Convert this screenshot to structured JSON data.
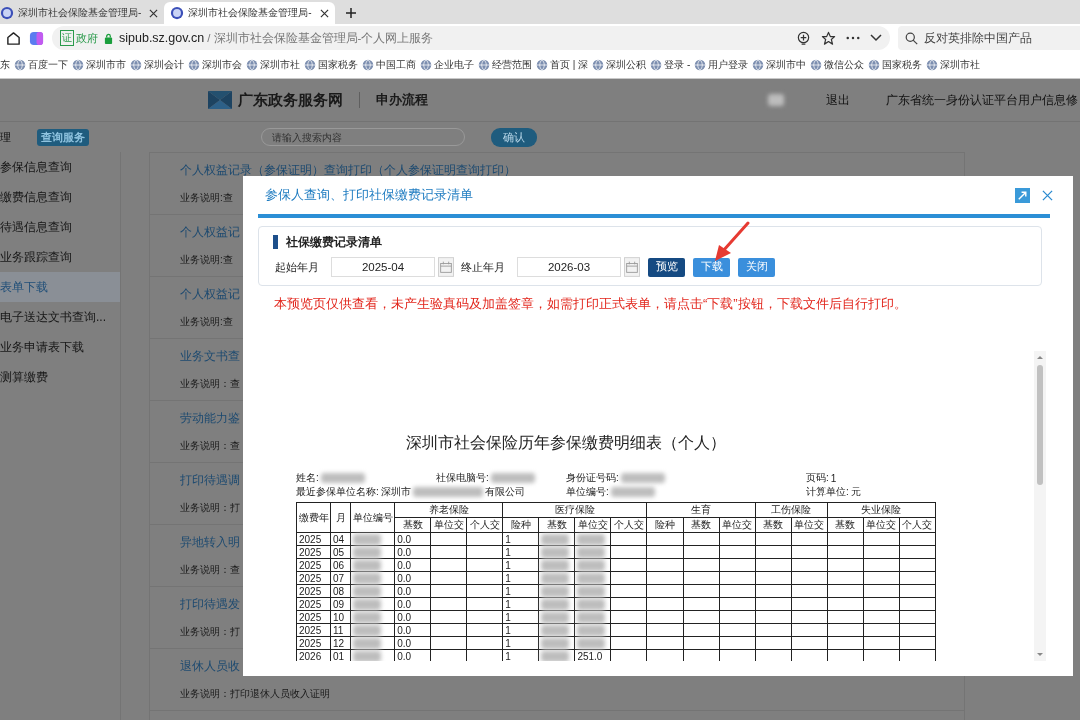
{
  "browser": {
    "tabs": [
      {
        "title": "深圳市社会保险基金管理局-",
        "selected": false
      },
      {
        "title": "深圳市社会保险基金管理局-",
        "selected": true
      }
    ],
    "address": {
      "badge_mark": "证",
      "badge": "政府",
      "domain": "sipub.sz.gov.cn",
      "path": "/ 深圳市社会保险基金管理局-个人网上服务"
    },
    "search": {
      "placeholder": "反对英排除中国产品"
    },
    "bookmarks": [
      {
        "label": "东",
        "icon": false
      },
      {
        "label": "百度一下",
        "icon": true
      },
      {
        "label": "深圳市市",
        "icon": true
      },
      {
        "label": "深圳会计",
        "icon": true
      },
      {
        "label": "深圳市会",
        "icon": true
      },
      {
        "label": "深圳市社",
        "icon": true
      },
      {
        "label": "国家税务",
        "icon": true
      },
      {
        "label": "中国工商",
        "icon": true
      },
      {
        "label": "企业电子",
        "icon": true
      },
      {
        "label": "经营范围",
        "icon": true
      },
      {
        "label": "首页 | 深",
        "icon": true
      },
      {
        "label": "深圳公积",
        "icon": true
      },
      {
        "label": "登录 -",
        "icon": true
      },
      {
        "label": "用户登录",
        "icon": true
      },
      {
        "label": "深圳市中",
        "icon": true
      },
      {
        "label": "微信公众",
        "icon": true
      },
      {
        "label": "国家税务",
        "icon": true
      },
      {
        "label": "深圳市社",
        "icon": true
      }
    ]
  },
  "site_header": {
    "title": "广东政务服务网",
    "subtitle": "申办流程",
    "user_redacted": true,
    "logout": "退出",
    "profile_link": "广东省统一身份认证平台用户信息修"
  },
  "toolbar": {
    "section_label": "理",
    "category_tab": "查询服务",
    "search": {
      "placeholder": "请输入搜索内容"
    },
    "confirm_button": "确认"
  },
  "sidebar": {
    "items": [
      {
        "label": "参保信息查询",
        "selected": false
      },
      {
        "label": "缴费信息查询",
        "selected": false
      },
      {
        "label": "待遇信息查询",
        "selected": false
      },
      {
        "label": "业务跟踪查询",
        "selected": false
      },
      {
        "label": "表单下载",
        "selected": true
      },
      {
        "label": "电子送达文书查询...",
        "selected": false
      },
      {
        "label": "业务申请表下载",
        "selected": false
      },
      {
        "label": "测算缴费",
        "selected": false
      }
    ]
  },
  "services": [
    {
      "title": "个人权益记录（参保证明）查询打印（个人参保证明查询打印）",
      "description": "业务说明:查"
    },
    {
      "title": "个人权益记",
      "description": "业务说明:查"
    },
    {
      "title": "个人权益记",
      "description": "业务说明:查"
    },
    {
      "title": "业务文书查",
      "description": "业务说明：查"
    },
    {
      "title": "劳动能力鉴",
      "description": "业务说明：查"
    },
    {
      "title": "打印待遇调",
      "description": "业务说明：打"
    },
    {
      "title": "异地转入明",
      "description": "业务说明：查"
    },
    {
      "title": "打印待遇发",
      "description": "业务说明：打"
    },
    {
      "title": "退休人员收",
      "description": "业务说明：打印退休人员收入证明"
    }
  ],
  "dialog": {
    "title": "参保人查询、打印社保缴费记录清单",
    "form": {
      "heading": "社保缴费记录清单",
      "start_label": "起始年月",
      "start_value": "2025-04",
      "end_label": "终止年月",
      "end_value": "2026-03",
      "buttons": [
        {
          "label": "预览",
          "kind": "primary"
        },
        {
          "label": "下载",
          "kind": "normal"
        },
        {
          "label": "关闭",
          "kind": "normal"
        }
      ]
    },
    "notice": "本预览页仅供查看，未产生验真码及加盖签章，如需打印正式表单，请点击“下载”按钮，下载文件后自行打印。",
    "document": {
      "title": "深圳市社会保险历年参保缴费明细表（个人）",
      "info_rows": [
        [
          {
            "label": "姓名:",
            "redacted": true
          },
          {
            "label": "社保电脑号:",
            "redacted": true
          },
          {
            "label": "身份证号码:",
            "redacted": true
          },
          {
            "label": "页码:",
            "value": "1"
          }
        ],
        [
          {
            "label": "最近参保单位名称:",
            "value": "深圳市",
            "redacted": true,
            "value_end": "有限公司"
          },
          {
            "label": "单位编号:",
            "redacted": true
          },
          {
            "label": "计算单位:",
            "value": "元"
          }
        ]
      ],
      "fixed_columns": [
        "缴费年",
        "月",
        "单位编号"
      ],
      "groups": [
        {
          "label": "养老保险",
          "columns": [
            "基数",
            "单位交",
            "个人交"
          ]
        },
        {
          "label": "医疗保险",
          "columns": [
            "险种",
            "基数",
            "单位交",
            "个人交"
          ]
        },
        {
          "label": "生育",
          "columns": [
            "险种",
            "基数",
            "单位交"
          ]
        },
        {
          "label": "工伤保险",
          "columns": [
            "基数",
            "单位交"
          ]
        },
        {
          "label": "失业保险",
          "columns": [
            "基数",
            "单位交",
            "个人交"
          ]
        }
      ],
      "rows": [
        {
          "cells": [
            {
              "text": "2025"
            },
            {
              "text": "04"
            },
            {
              "redacted": true
            },
            {
              "text": "0.0"
            },
            {},
            {},
            {
              "text": "1"
            },
            {
              "redacted": true
            },
            {
              "redacted": true
            }
          ]
        },
        {
          "cells": [
            {
              "text": "2025"
            },
            {
              "text": "05"
            },
            {
              "redacted": true
            },
            {
              "text": "0.0"
            },
            {},
            {},
            {
              "text": "1"
            },
            {
              "redacted": true
            },
            {
              "redacted": true
            }
          ]
        },
        {
          "cells": [
            {
              "text": "2025"
            },
            {
              "text": "06"
            },
            {
              "redacted": true
            },
            {
              "text": "0.0"
            },
            {},
            {},
            {
              "text": "1"
            },
            {
              "redacted": true
            },
            {
              "redacted": true
            }
          ]
        },
        {
          "cells": [
            {
              "text": "2025"
            },
            {
              "text": "07"
            },
            {
              "redacted": true
            },
            {
              "text": "0.0"
            },
            {},
            {},
            {
              "text": "1"
            },
            {
              "redacted": true
            },
            {
              "redacted": true
            }
          ]
        },
        {
          "cells": [
            {
              "text": "2025"
            },
            {
              "text": "08"
            },
            {
              "redacted": true
            },
            {
              "text": "0.0"
            },
            {},
            {},
            {
              "text": "1"
            },
            {
              "redacted": true
            },
            {
              "redacted": true
            }
          ]
        },
        {
          "cells": [
            {
              "text": "2025"
            },
            {
              "text": "09"
            },
            {
              "redacted": true
            },
            {
              "text": "0.0"
            },
            {},
            {},
            {
              "text": "1"
            },
            {
              "redacted": true
            },
            {
              "redacted": true
            }
          ]
        },
        {
          "cells": [
            {
              "text": "2025"
            },
            {
              "text": "10"
            },
            {
              "redacted": true
            },
            {
              "text": "0.0"
            },
            {},
            {},
            {
              "text": "1"
            },
            {
              "redacted": true
            },
            {
              "redacted": true
            }
          ]
        },
        {
          "cells": [
            {
              "text": "2025"
            },
            {
              "text": "11"
            },
            {
              "redacted": true
            },
            {
              "text": "0.0"
            },
            {},
            {},
            {
              "text": "1"
            },
            {
              "redacted": true
            },
            {
              "redacted": true
            }
          ]
        },
        {
          "cells": [
            {
              "text": "2025"
            },
            {
              "text": "12"
            },
            {
              "redacted": true
            },
            {
              "text": "0.0"
            },
            {},
            {},
            {
              "text": "1"
            },
            {
              "redacted": true
            },
            {
              "redacted": true
            }
          ]
        },
        {
          "cells": [
            {
              "text": "2026"
            },
            {
              "text": "01"
            },
            {
              "redacted": true
            },
            {
              "text": "0.0"
            },
            {},
            {},
            {
              "text": "1"
            },
            {
              "redacted": true
            },
            {
              "text": "251.0"
            }
          ]
        }
      ]
    }
  }
}
